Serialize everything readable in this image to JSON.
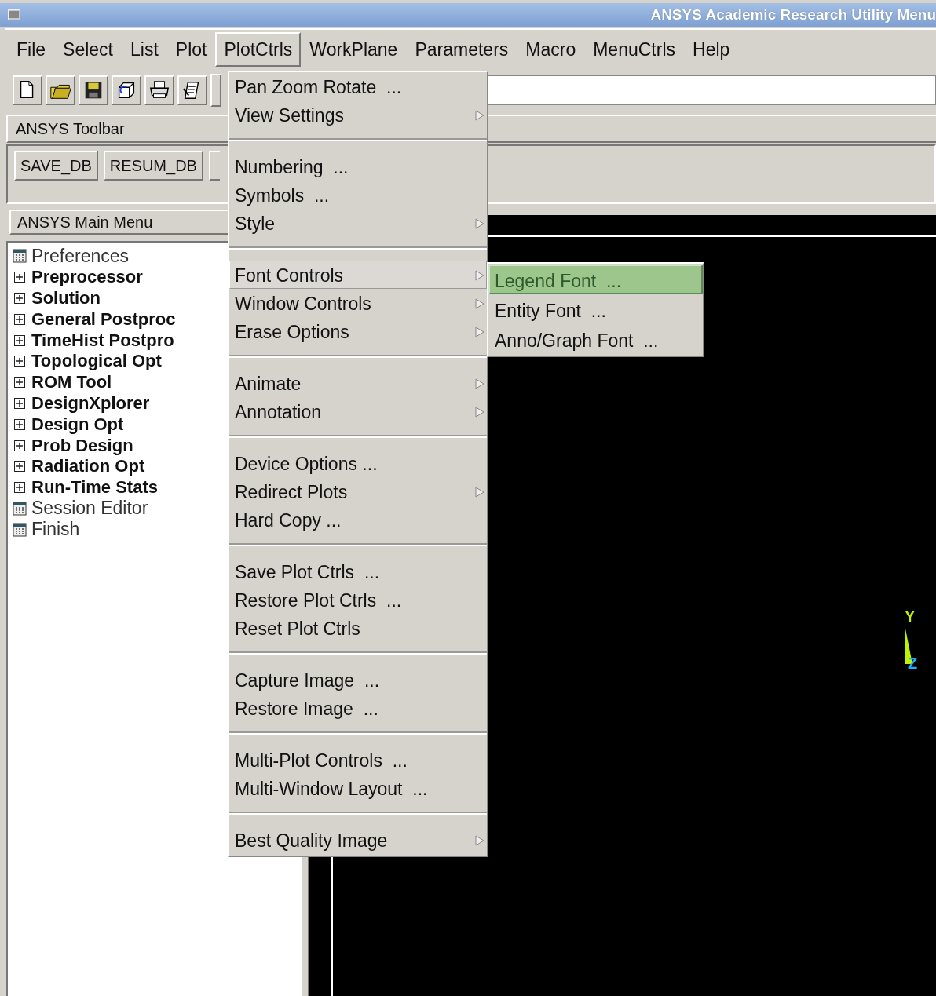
{
  "window": {
    "title": "ANSYS Academic Research Utility Menu"
  },
  "menubar": {
    "items": [
      {
        "label": "File",
        "selected": false
      },
      {
        "label": "Select",
        "selected": false
      },
      {
        "label": "List",
        "selected": false
      },
      {
        "label": "Plot",
        "selected": false
      },
      {
        "label": "PlotCtrls",
        "selected": true
      },
      {
        "label": "WorkPlane",
        "selected": false
      },
      {
        "label": "Parameters",
        "selected": false
      },
      {
        "label": "Macro",
        "selected": false
      },
      {
        "label": "MenuCtrls",
        "selected": false
      },
      {
        "label": "Help",
        "selected": false
      }
    ]
  },
  "ansys_toolbar": {
    "title": "ANSYS Toolbar",
    "buttons": [
      "SAVE_DB",
      "RESUM_DB"
    ]
  },
  "main_menu": {
    "title": "ANSYS Main Menu",
    "items": [
      {
        "label": "Preferences",
        "kind": "dialog"
      },
      {
        "label": "Preprocessor",
        "kind": "folder",
        "expanded": false
      },
      {
        "label": "Solution",
        "kind": "folder",
        "expanded": false
      },
      {
        "label": "General Postproc",
        "kind": "folder",
        "expanded": false
      },
      {
        "label": "TimeHist Postpro",
        "kind": "folder",
        "expanded": false
      },
      {
        "label": "Topological Opt",
        "kind": "folder",
        "expanded": false
      },
      {
        "label": "ROM Tool",
        "kind": "folder",
        "expanded": false
      },
      {
        "label": "DesignXplorer",
        "kind": "folder",
        "expanded": false
      },
      {
        "label": "Design Opt",
        "kind": "folder",
        "expanded": false
      },
      {
        "label": "Prob Design",
        "kind": "folder",
        "expanded": false
      },
      {
        "label": "Radiation Opt",
        "kind": "folder",
        "expanded": false
      },
      {
        "label": "Run-Time Stats",
        "kind": "folder",
        "expanded": false
      },
      {
        "label": "Session Editor",
        "kind": "dialog"
      },
      {
        "label": "Finish",
        "kind": "dialog"
      }
    ]
  },
  "plotctrls_menu": {
    "sections": [
      {
        "items": [
          {
            "label": "Pan Zoom Rotate  ...",
            "kind": "command",
            "selected": false
          },
          {
            "label": "View Settings",
            "kind": "submenu",
            "selected": false
          }
        ]
      },
      {
        "items": [
          {
            "label": "Numbering  ...",
            "kind": "command",
            "selected": false
          },
          {
            "label": "Symbols  ...",
            "kind": "command",
            "selected": false
          },
          {
            "label": "Style",
            "kind": "submenu",
            "selected": false
          }
        ]
      },
      {
        "items": [
          {
            "label": "Font Controls",
            "kind": "submenu",
            "selected": true
          },
          {
            "label": "Window Controls",
            "kind": "submenu",
            "selected": false
          },
          {
            "label": "Erase Options",
            "kind": "submenu",
            "selected": false
          }
        ]
      },
      {
        "items": [
          {
            "label": "Animate",
            "kind": "submenu",
            "selected": false
          },
          {
            "label": "Annotation",
            "kind": "submenu",
            "selected": false
          }
        ]
      },
      {
        "items": [
          {
            "label": "Device Options ...",
            "kind": "command",
            "selected": false
          },
          {
            "label": "Redirect Plots",
            "kind": "submenu",
            "selected": false
          },
          {
            "label": "Hard Copy ...",
            "kind": "command",
            "selected": false
          }
        ]
      },
      {
        "items": [
          {
            "label": "Save Plot Ctrls  ...",
            "kind": "command",
            "selected": false
          },
          {
            "label": "Restore Plot Ctrls  ...",
            "kind": "command",
            "selected": false
          },
          {
            "label": "Reset Plot Ctrls",
            "kind": "command",
            "selected": false
          }
        ]
      },
      {
        "items": [
          {
            "label": "Capture Image  ...",
            "kind": "command",
            "selected": false
          },
          {
            "label": "Restore Image  ...",
            "kind": "command",
            "selected": false
          }
        ]
      },
      {
        "items": [
          {
            "label": "Multi-Plot Controls  ...",
            "kind": "command",
            "selected": false
          },
          {
            "label": "Multi-Window Layout  ...",
            "kind": "command",
            "selected": false
          }
        ]
      },
      {
        "items": [
          {
            "label": "Best Quality Image",
            "kind": "submenu",
            "selected": false
          }
        ]
      }
    ]
  },
  "font_controls_submenu": {
    "items": [
      {
        "label": "Legend Font  ...",
        "selected": true
      },
      {
        "label": "Entity Font  ...",
        "selected": false
      },
      {
        "label": "Anno/Graph Font  ...",
        "selected": false
      }
    ]
  },
  "graphics": {
    "triad": {
      "y_label": "Y",
      "z_label": "Z"
    }
  }
}
